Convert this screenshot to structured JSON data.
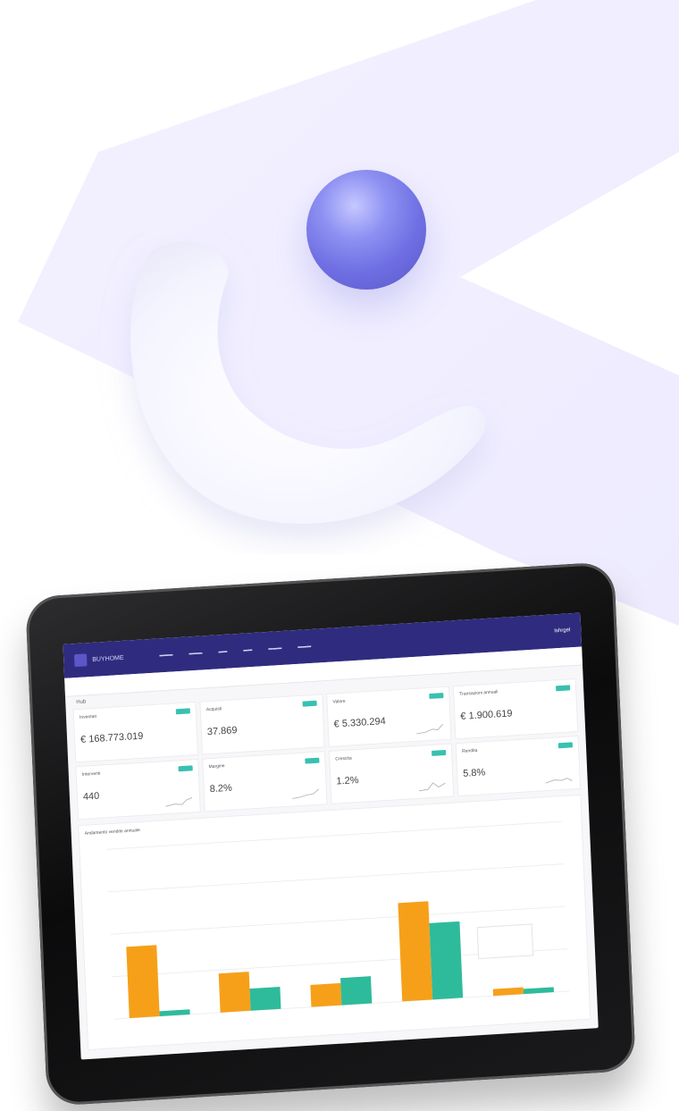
{
  "dashboard": {
    "header": {
      "brand": "BUYHOME",
      "user": "Ishrgel"
    },
    "page_label": "Hub",
    "cards": [
      {
        "title": "Inventari",
        "value": "€ 168.773.019",
        "badge": ""
      },
      {
        "title": "Acquisti",
        "value": "37.869",
        "badge": ""
      },
      {
        "title": "Valore",
        "value": "€ 5.330.294",
        "badge": ""
      },
      {
        "title": "Transazioni annuali",
        "value": "€ 1.900.619",
        "badge": ""
      },
      {
        "title": "Interventi",
        "value": "440",
        "badge": ""
      },
      {
        "title": "Margine",
        "value": "8.2%",
        "badge": ""
      },
      {
        "title": "Crescita",
        "value": "1.2%",
        "badge": ""
      },
      {
        "title": "Rendita",
        "value": "5.8%",
        "badge": ""
      }
    ],
    "chart_title": "Andamento vendite annuale"
  },
  "colors": {
    "accent": "#2f2c80",
    "orange": "#f6a01a",
    "teal": "#2ebb9b",
    "badge": "#38c1b0",
    "sphere": "#6f6fe3",
    "background_shape": "#f0eefe"
  },
  "chart_data": {
    "type": "bar",
    "categories": [
      "",
      "",
      "",
      "",
      ""
    ],
    "series": [
      {
        "values": [
          42,
          23,
          13,
          58,
          4
        ],
        "color": "#f6a01a"
      },
      {
        "values": [
          3,
          13,
          16,
          45,
          3
        ],
        "color": "#2ebb9b"
      }
    ],
    "ylim": [
      0,
      100
    ],
    "grid": true
  }
}
